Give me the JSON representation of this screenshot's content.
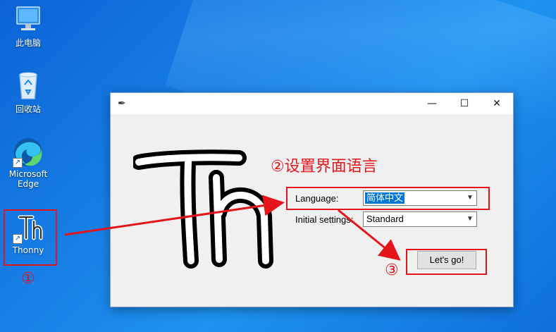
{
  "desktop": {
    "icons": [
      {
        "label": "此电脑",
        "icon": "computer-icon"
      },
      {
        "label": "回收站",
        "icon": "recycle-bin-icon"
      },
      {
        "label_line1": "Microsoft",
        "label_line2": "Edge",
        "icon": "edge-icon"
      },
      {
        "label": "Thonny",
        "icon": "thonny-icon"
      }
    ]
  },
  "window": {
    "title": "",
    "buttons": {
      "minimize": "—",
      "maximize": "☐",
      "close": "✕"
    },
    "language_label": "Language:",
    "language_value": "简体中文",
    "initial_settings_label": "Initial settings:",
    "initial_settings_value": "Standard",
    "go_button": "Let's go!"
  },
  "annotations": {
    "step1": "①",
    "step2": "②设置界面语言",
    "step3": "③",
    "color": "#e4141b"
  }
}
